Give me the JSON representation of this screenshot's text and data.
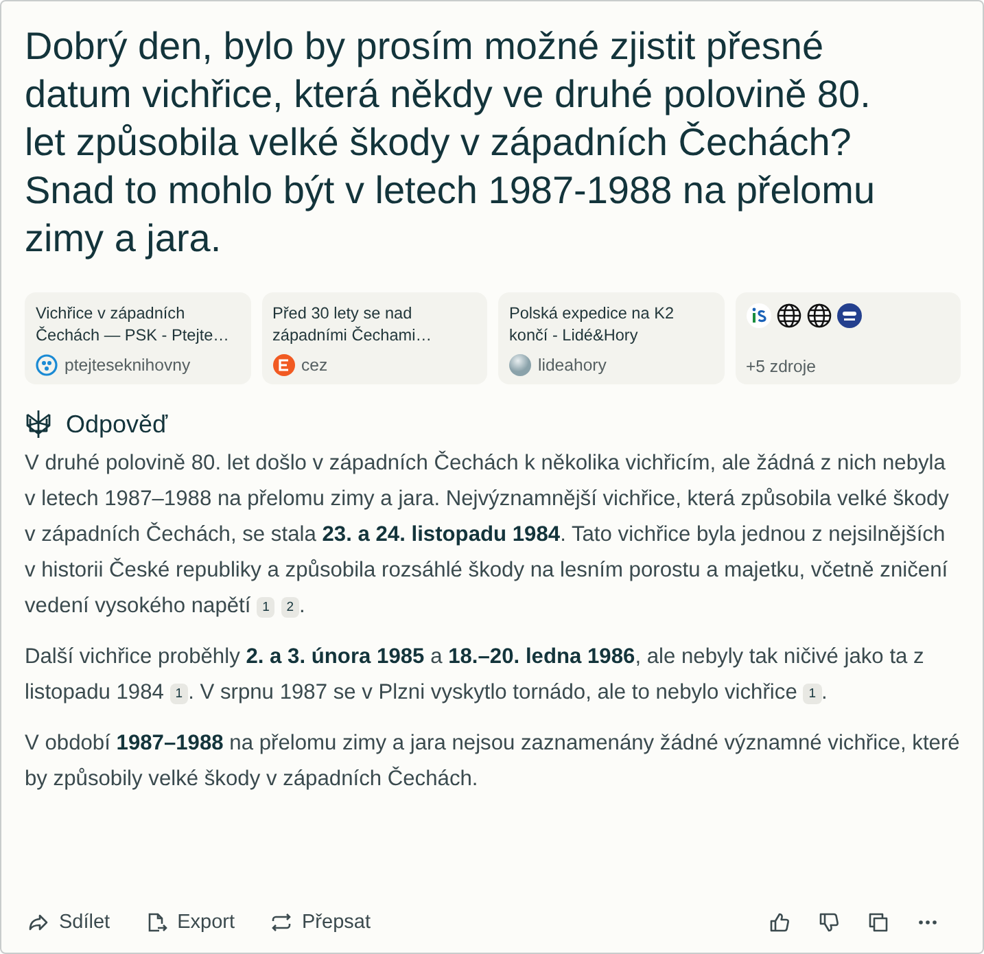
{
  "question": "Dobrý den, bylo by prosím možné zjistit přesné datum vichřice, která někdy ve druhé polovině 80. let způsobila velké škody v západních Čechách?\nSnad to mohlo být v letech 1987-1988 na přelomu zimy a jara.",
  "sources": [
    {
      "kind": "source",
      "title": "Vichřice v západních Čechách — PSK - Ptejte…",
      "site": "ptejteseknihovny"
    },
    {
      "kind": "source",
      "title": "Před 30 lety se nad západními Čechami…",
      "site": "cez"
    },
    {
      "kind": "source",
      "title": "Polská expedice na K2 končí - Lidé&Hory",
      "site": "lideahory"
    },
    {
      "kind": "more",
      "label": "+5 zdroje"
    }
  ],
  "answer_heading": "Odpověď",
  "paragraphs": [
    [
      {
        "kind": "text",
        "text": "V druhé polovině 80. let došlo v západních Čechách k několika vichřicím, ale žádná z nich nebyla v letech 1987–1988 na přelomu zimy a jara. Nejvýznamnější vichřice, která způsobila velké škody v západních Čechách, se stala **23. a 24. listopadu 1984**. Tato vichřice byla jednou z nejsilnějších v historii České republiky a způsobila rozsáhlé škody na lesním porostu a majetku, včetně zničení vedení vysokého napětí"
      },
      {
        "kind": "cite",
        "text": "1"
      },
      {
        "kind": "cite",
        "text": "2"
      },
      {
        "kind": "text",
        "text": "."
      }
    ],
    [
      {
        "kind": "text",
        "text": "Další vichřice proběhly **2. a 3. února 1985** a **18.–20. ledna 1986**, ale nebyly tak ničivé jako ta z listopadu 1984"
      },
      {
        "kind": "cite",
        "text": "1"
      },
      {
        "kind": "text",
        "text": ". V srpnu 1987 se v Plzni vyskytlo tornádo, ale to nebylo vichřice"
      },
      {
        "kind": "cite",
        "text": "1"
      },
      {
        "kind": "text",
        "text": "."
      }
    ],
    [
      {
        "kind": "text",
        "text": "V období **1987–1988** na přelomu zimy a jara nejsou zaznamenány žádné významné vichřice, které by způsobily velké škody v západních Čechách."
      }
    ]
  ],
  "actions": [
    "Sdílet",
    "Export",
    "Přepsat"
  ]
}
